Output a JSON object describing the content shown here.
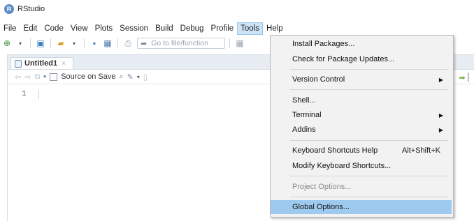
{
  "window": {
    "title": "RStudio"
  },
  "menubar": [
    "File",
    "Edit",
    "Code",
    "View",
    "Plots",
    "Session",
    "Build",
    "Debug",
    "Profile",
    "Tools",
    "Help"
  ],
  "toolbar": {
    "goto_placeholder": "Go to file/function"
  },
  "editor": {
    "tab_label": "Untitled1",
    "tab_close": "×",
    "source_on_save_label": "Source on Save",
    "line_number": "1"
  },
  "tools_menu": {
    "items": [
      {
        "label": "Install Packages..."
      },
      {
        "label": "Check for Package Updates..."
      },
      {
        "label": "Version Control",
        "submenu": true
      },
      {
        "label": "Shell..."
      },
      {
        "label": "Terminal",
        "submenu": true
      },
      {
        "label": "Addins",
        "submenu": true
      },
      {
        "label": "Keyboard Shortcuts Help",
        "shortcut": "Alt+Shift+K"
      },
      {
        "label": "Modify Keyboard Shortcuts..."
      },
      {
        "label": "Project Options...",
        "disabled": true
      },
      {
        "label": "Global Options...",
        "highlighted": true
      }
    ]
  },
  "colors": {
    "highlight": "#9fcaf0",
    "menu_active": "#cde4f7",
    "tabstrip": "#e7edf3"
  }
}
